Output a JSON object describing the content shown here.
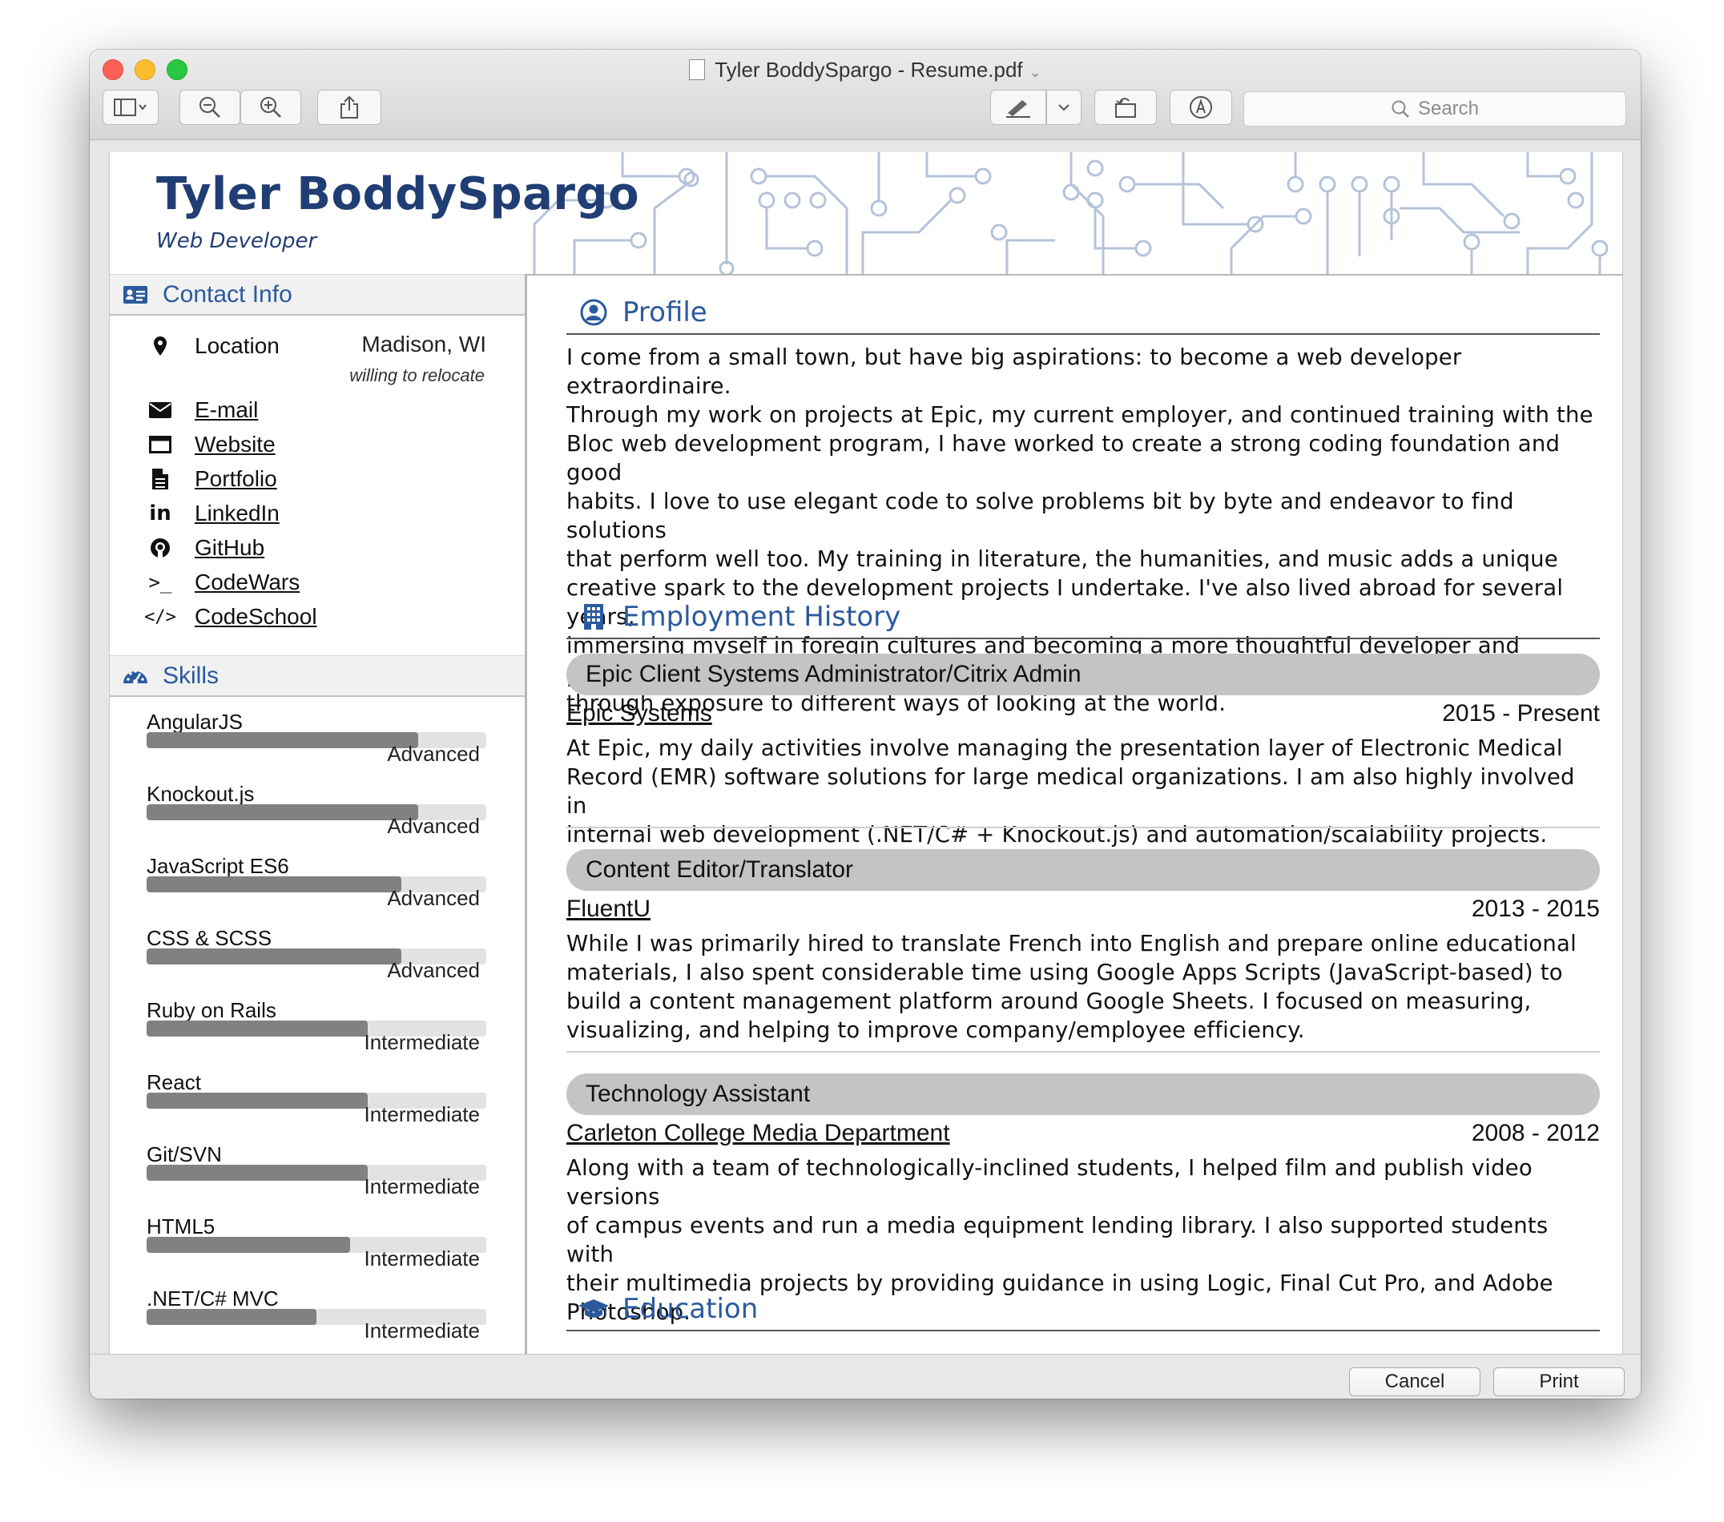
{
  "window": {
    "title": "Tyler BoddySpargo - Resume.pdf"
  },
  "toolbar": {
    "search_placeholder": "Search"
  },
  "resume": {
    "name": "Tyler BoddySpargo",
    "title": "Web Developer",
    "contact": {
      "heading": "Contact Info",
      "location_label": "Location",
      "location_value": "Madison, WI",
      "relocate": "willing to relocate",
      "links": [
        {
          "label": "E-mail",
          "icon": "envelope-icon"
        },
        {
          "label": "Website",
          "icon": "browser-window-icon"
        },
        {
          "label": "Portfolio",
          "icon": "document-icon"
        },
        {
          "label": "LinkedIn",
          "icon": "linkedin-icon"
        },
        {
          "label": "GitHub",
          "icon": "github-icon"
        },
        {
          "label": "CodeWars",
          "icon": "terminal-icon"
        },
        {
          "label": "CodeSchool",
          "icon": "code-icon"
        }
      ]
    },
    "skills": {
      "heading": "Skills",
      "items": [
        {
          "name": "AngularJS",
          "level": "Advanced",
          "value": 0.8
        },
        {
          "name": "Knockout.js",
          "level": "Advanced",
          "value": 0.8
        },
        {
          "name": "JavaScript ES6",
          "level": "Advanced",
          "value": 0.75
        },
        {
          "name": "CSS & SCSS",
          "level": "Advanced",
          "value": 0.75
        },
        {
          "name": "Ruby on Rails",
          "level": "Intermediate",
          "value": 0.65
        },
        {
          "name": "React",
          "level": "Intermediate",
          "value": 0.65
        },
        {
          "name": "Git/SVN",
          "level": "Intermediate",
          "value": 0.65
        },
        {
          "name": "HTML5",
          "level": "Intermediate",
          "value": 0.6
        },
        {
          "name": ".NET/C# MVC",
          "level": "Intermediate",
          "value": 0.5
        }
      ]
    },
    "profile": {
      "heading": "Profile",
      "lines": [
        "I come from a small town, but have big aspirations: to become a web developer extraordinaire.",
        "Through my work on projects at Epic, my current employer, and continued training with the",
        "Bloc web development program, I have worked to create a strong coding foundation and good",
        "habits. I love to use elegant code to solve problems bit by byte and endeavor to find solutions",
        "that perform well too. My training in literature, the humanities, and music adds a unique",
        "creative spark to the development projects I undertake. I've also lived abroad for several years,",
        "immersing myself in foregin cultures and becoming a more thoughtful developer and person",
        "through exposure to different ways of looking at the world."
      ]
    },
    "employment": {
      "heading": "Employment History",
      "jobs": [
        {
          "title": "Epic Client Systems Administrator/Citrix Admin",
          "employer": "Epic Systems",
          "years": "2015 - Present",
          "lines": [
            "At Epic, my daily activities involve managing the presentation layer of Electronic Medical",
            "Record (EMR) software solutions for large medical organizations. I am also highly involved in",
            "internal web development (.NET/C# + Knockout.js) and automation/scalability projects."
          ]
        },
        {
          "title": "Content Editor/Translator",
          "employer": "FluentU",
          "years": "2013 - 2015",
          "lines": [
            "While I was primarily hired to translate French into English and prepare online educational",
            "materials, I also spent considerable time using Google Apps Scripts (JavaScript-based) to",
            "build a content management platform around Google Sheets. I focused on measuring,",
            "visualizing, and helping to improve company/employee efficiency."
          ]
        },
        {
          "title": "Technology Assistant",
          "employer": "Carleton College Media Department",
          "years": "2008 - 2012",
          "lines": [
            "Along with a team of technologically-inclined students, I helped film and publish video versions",
            "of campus events and run a media equipment lending library. I also supported students with",
            "their multimedia projects by providing guidance in using Logic, Final Cut Pro, and Adobe",
            "Photoshop."
          ]
        }
      ]
    },
    "education": {
      "heading": "Education"
    }
  },
  "dialog": {
    "cancel": "Cancel",
    "print": "Print"
  },
  "colors": {
    "accent": "#2a5a9e",
    "name": "#203d74",
    "bar_fill": "#818181",
    "bar_track": "#e2e2e2",
    "job_bar": "#c4c4c4"
  }
}
